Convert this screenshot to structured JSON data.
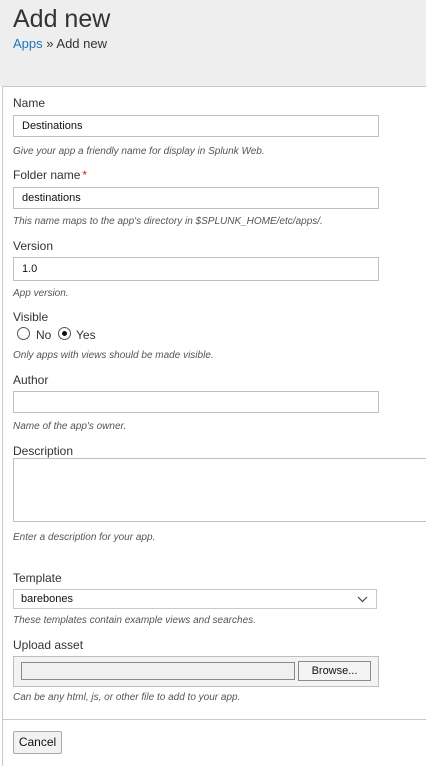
{
  "header": {
    "title": "Add new",
    "breadcrumb": {
      "parent": "Apps",
      "separator": "»",
      "current": "Add new"
    }
  },
  "form": {
    "name": {
      "label": "Name",
      "value": "Destinations",
      "help": "Give your app a friendly name for display in Splunk Web."
    },
    "folder": {
      "label": "Folder name",
      "required_mark": "*",
      "value": "destinations",
      "help": "This name maps to the app's directory in $SPLUNK_HOME/etc/apps/."
    },
    "version": {
      "label": "Version",
      "value": "1.0",
      "help": "App version."
    },
    "visible": {
      "label": "Visible",
      "options": [
        "No",
        "Yes"
      ],
      "selected": "Yes",
      "help": "Only apps with views should be made visible."
    },
    "author": {
      "label": "Author",
      "value": "",
      "help": "Name of the app's owner."
    },
    "description": {
      "label": "Description",
      "value": "",
      "help": "Enter a description for your app."
    },
    "template": {
      "label": "Template",
      "value": "barebones",
      "help": "These templates contain example views and searches."
    },
    "upload": {
      "label": "Upload asset",
      "browse_label": "Browse...",
      "help": "Can be any html, js, or other file to add to your app."
    }
  },
  "actions": {
    "cancel_label": "Cancel"
  },
  "colors": {
    "link": "#1e73be",
    "required": "#d6211f",
    "header_bg": "#eeeeee"
  }
}
